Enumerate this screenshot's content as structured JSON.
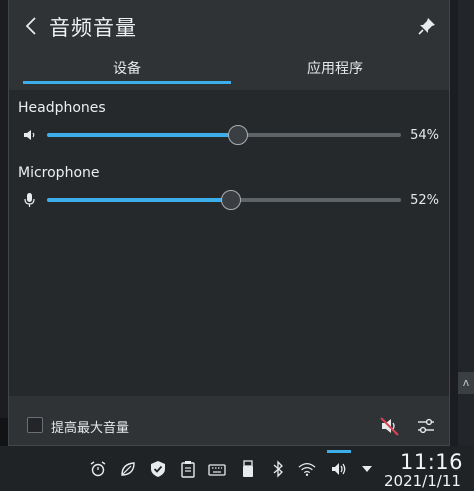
{
  "popup": {
    "title": "音频音量",
    "tabs": [
      {
        "label": "设备",
        "active": true
      },
      {
        "label": "应用程序",
        "active": false
      }
    ],
    "devices": [
      {
        "name": "Headphones",
        "icon": "speaker-icon",
        "percent_label": "54%",
        "level": 0.54
      },
      {
        "name": "Microphone",
        "icon": "microphone-icon",
        "percent_label": "52%",
        "level": 0.52
      }
    ],
    "footer": {
      "raise_max_label": "提高最大音量",
      "raise_max_checked": false
    }
  },
  "taskbar": {
    "tray_icons": [
      "alarm-icon",
      "leaf-icon",
      "shield-check-icon",
      "clipboard-icon",
      "keyboard-icon",
      "usb-drive-icon",
      "bluetooth-icon",
      "wifi-icon",
      "volume-icon",
      "expand-arrow-icon"
    ],
    "time": "11:16",
    "date": "2021/1/11"
  },
  "colors": {
    "accent": "#3daee9",
    "popup_bg": "#2f3336",
    "taskbar_bg": "#202326"
  }
}
